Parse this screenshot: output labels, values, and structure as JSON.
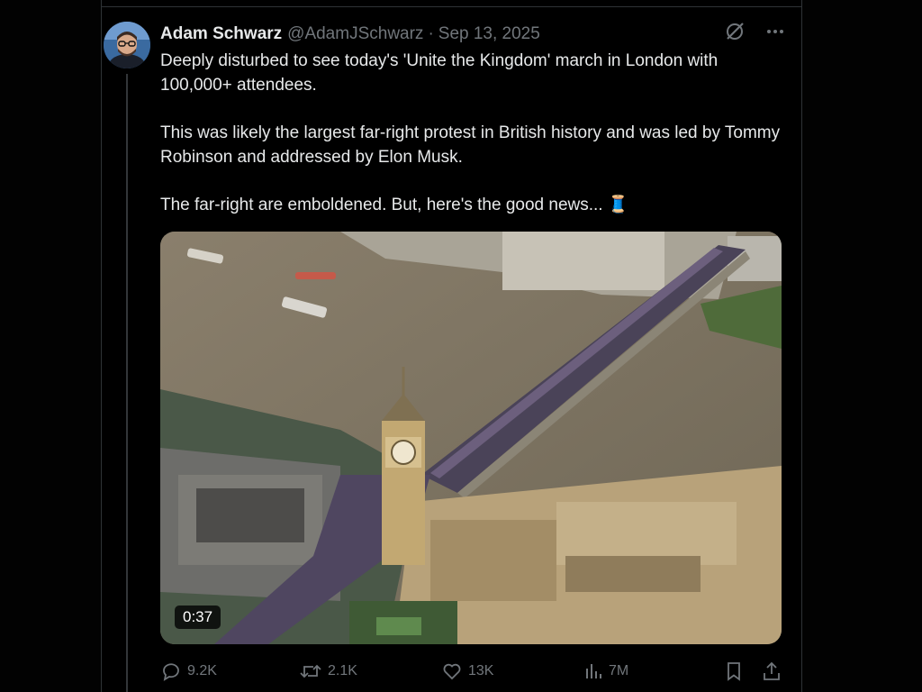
{
  "tweet": {
    "author_name": "Adam Schwarz",
    "handle": "@AdamJSchwarz",
    "separator": "·",
    "date": "Sep 13, 2025",
    "paragraphs": [
      "Deeply disturbed to see today's 'Unite the Kingdom' march in London with 100,000+ attendees.",
      "This was likely the largest far-right protest in British history and was led by Tommy Robinson and addressed by Elon Musk.",
      "The far-right are emboldened. But, here's the good news... 🧵"
    ],
    "video": {
      "duration": "0:37",
      "scene": "aerial-video-westminster-bridge"
    }
  },
  "actions": {
    "replies": "9.2K",
    "reposts": "2.1K",
    "likes": "13K",
    "views": "7M"
  },
  "icons": {
    "grok": "grok-icon",
    "more": "more-icon",
    "reply": "reply-icon",
    "repost": "repost-icon",
    "like": "like-icon",
    "views": "views-icon",
    "bookmark": "bookmark-icon",
    "share": "share-icon"
  },
  "colors": {
    "background": "#000000",
    "text": "#e7e9ea",
    "secondary": "#71767b",
    "border": "#2f3336"
  }
}
